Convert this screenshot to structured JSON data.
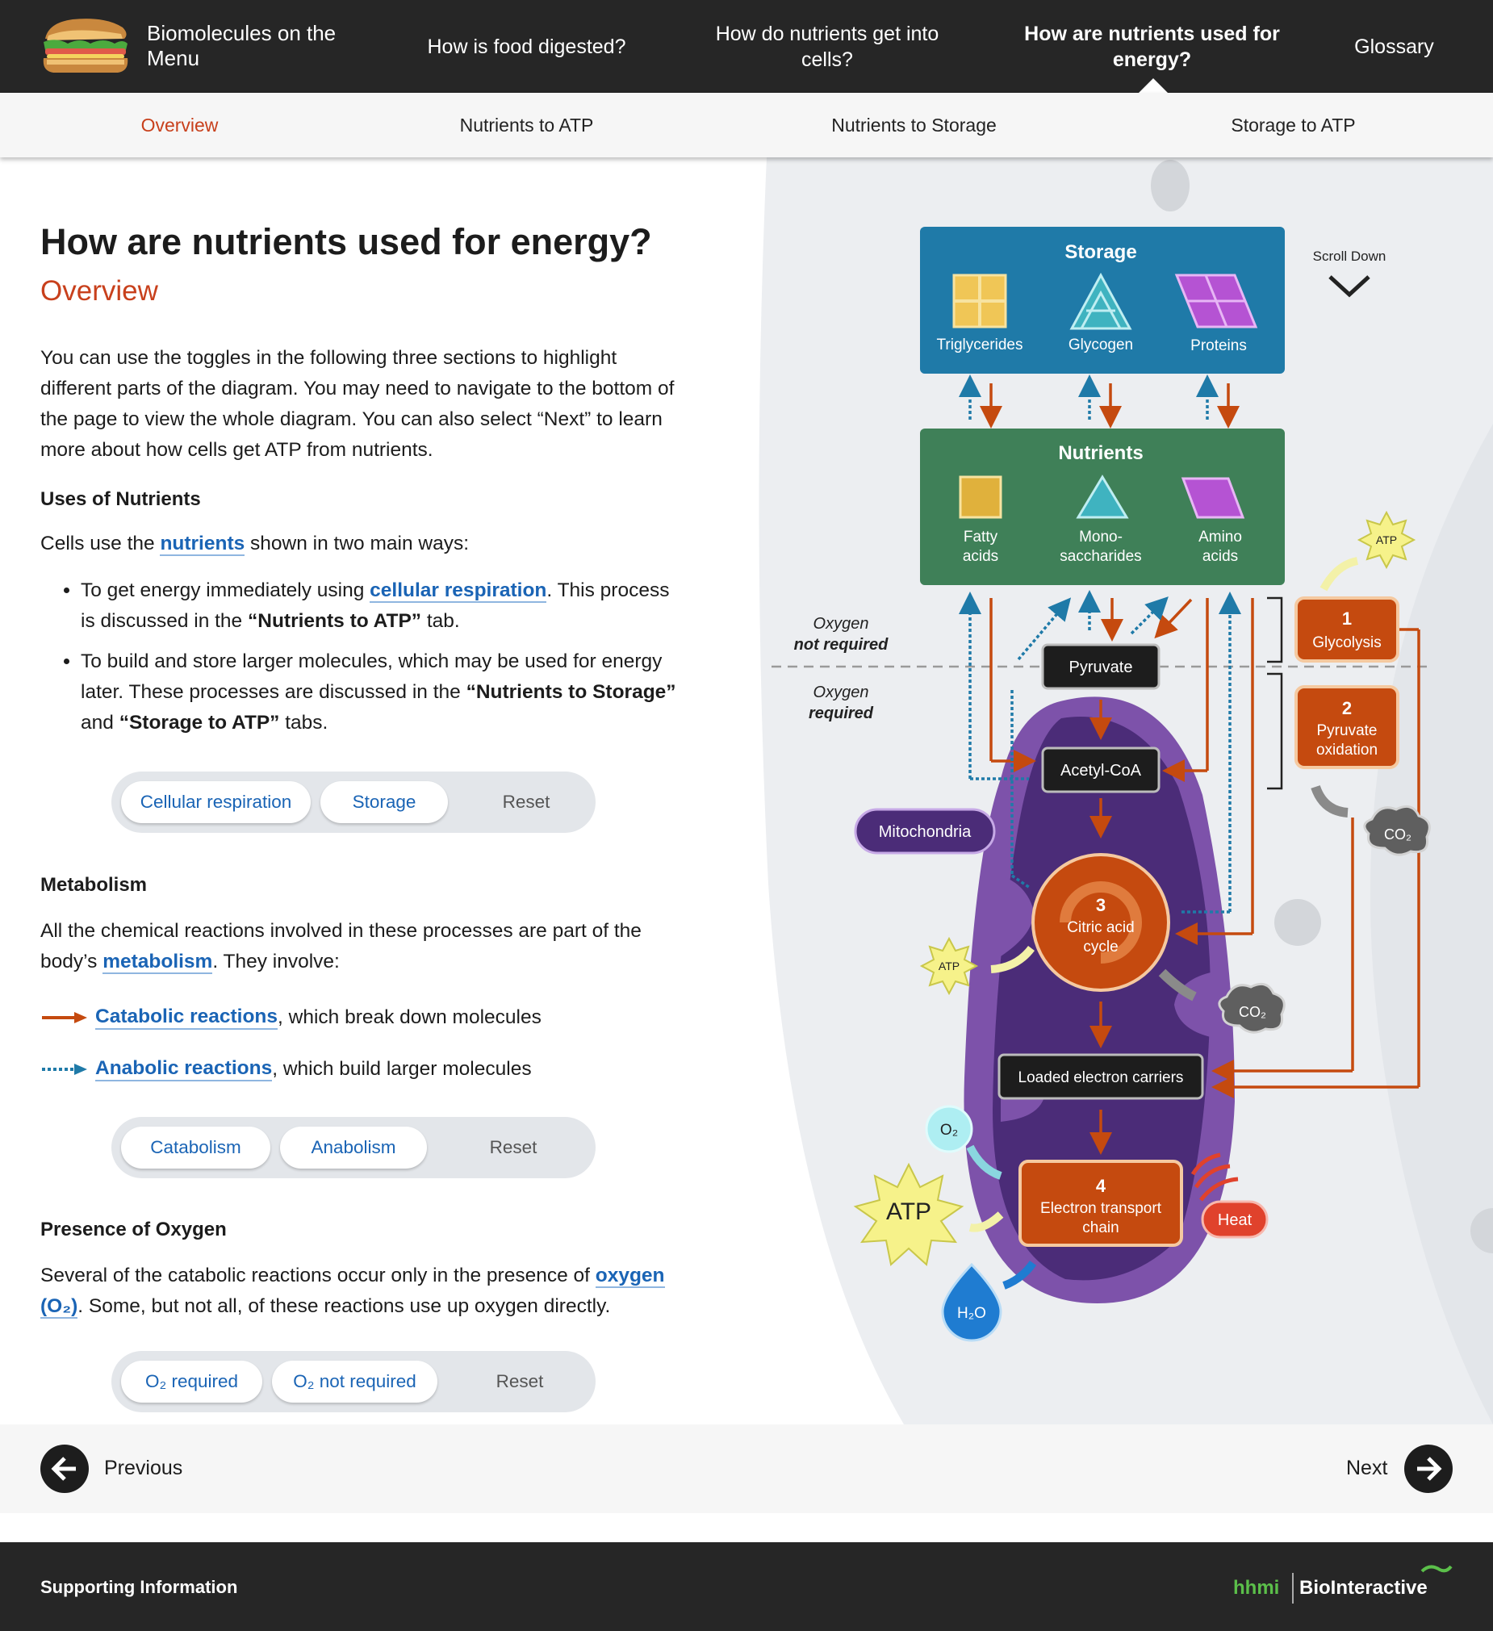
{
  "nav": {
    "brand": "Biomolecules on the Menu",
    "items": [
      "How is food digested?",
      "How do nutrients get into cells?",
      "How are nutrients used for energy?",
      "Glossary"
    ]
  },
  "subnav": {
    "items": [
      "Overview",
      "Nutrients to ATP",
      "Nutrients to Storage",
      "Storage to ATP"
    ]
  },
  "content": {
    "title": "How are nutrients used for energy?",
    "subtitle": "Overview",
    "intro": "You can use the toggles in the following three sections to highlight different parts of the diagram. You may need to navigate to the bottom of the page to view the whole diagram. You can also select “Next” to learn more about how cells get ATP from nutrients.",
    "uses": {
      "heading": "Uses of Nutrients",
      "lead_pre": "Cells use the ",
      "lead_link": "nutrients",
      "lead_post": " shown in two main ways:",
      "b1_pre": "To get energy immediately using ",
      "b1_link": "cellular respiration",
      "b1_mid": ". This process is discussed in the ",
      "b1_bold": "“Nutrients to ATP”",
      "b1_post": " tab.",
      "b2_pre": "To build and store larger molecules, which may be used for energy later. These processes are discussed in the ",
      "b2_bold1": "“Nutrients to Storage”",
      "b2_mid": " and ",
      "b2_bold2": "“Storage to ATP”",
      "b2_post": " tabs.",
      "toggles": [
        "Cellular respiration",
        "Storage"
      ],
      "reset": "Reset"
    },
    "metabolism": {
      "heading": "Metabolism",
      "lead_pre": "All the chemical reactions involved in these processes are part of the body’s ",
      "lead_link": "metabolism",
      "lead_post": ". They involve:",
      "cat_link": "Catabolic reactions",
      "cat_post": ", which break down molecules",
      "ana_link": "Anabolic reactions",
      "ana_post": ", which build larger molecules",
      "toggles": [
        "Catabolism",
        "Anabolism"
      ],
      "reset": "Reset"
    },
    "oxygen": {
      "heading": "Presence of Oxygen",
      "lead_pre": "Several of the catabolic reactions occur only in the presence of ",
      "lead_link": "oxygen (O₂)",
      "lead_post": ". Some, but not all, of these reactions use up oxygen directly.",
      "toggles": [
        "O₂ required",
        "O₂ not required"
      ],
      "reset": "Reset"
    }
  },
  "diagram": {
    "scroll": "Scroll Down",
    "storage": {
      "title": "Storage",
      "items": [
        "Triglycerides",
        "Glycogen",
        "Proteins"
      ]
    },
    "nutrients": {
      "title": "Nutrients",
      "items": [
        [
          "Fatty",
          "acids"
        ],
        [
          "Mono-",
          "saccharides"
        ],
        [
          "Amino",
          "acids"
        ]
      ]
    },
    "oxygen_not": [
      "Oxygen",
      "not required"
    ],
    "oxygen_req": [
      "Oxygen",
      "required"
    ],
    "pyruvate": "Pyruvate",
    "acetyl": "Acetyl-CoA",
    "mito": "Mitochondria",
    "citric": [
      "3",
      "Citric acid",
      "cycle"
    ],
    "loaded": "Loaded electron carriers",
    "etc": [
      "4",
      "Electron transport",
      "chain"
    ],
    "glycolysis": [
      "1",
      "Glycolysis"
    ],
    "pyrox": [
      "2",
      "Pyruvate",
      "oxidation"
    ],
    "atp": "ATP",
    "co2": "CO₂",
    "o2": "O₂",
    "h2o": "H₂O",
    "heat": "Heat"
  },
  "footer_nav": {
    "prev": "Previous",
    "next": "Next"
  },
  "footer": {
    "support": "Supporting Information",
    "logo_hhmi": "hhmi",
    "logo_bio": "BioInteractive"
  },
  "colors": {
    "accent": "#c8401c",
    "link": "#1a64b5",
    "storage": "#1f7aa8",
    "nutrients": "#3f8058",
    "step": "#c54a0f",
    "mito": "#7d52aa"
  }
}
